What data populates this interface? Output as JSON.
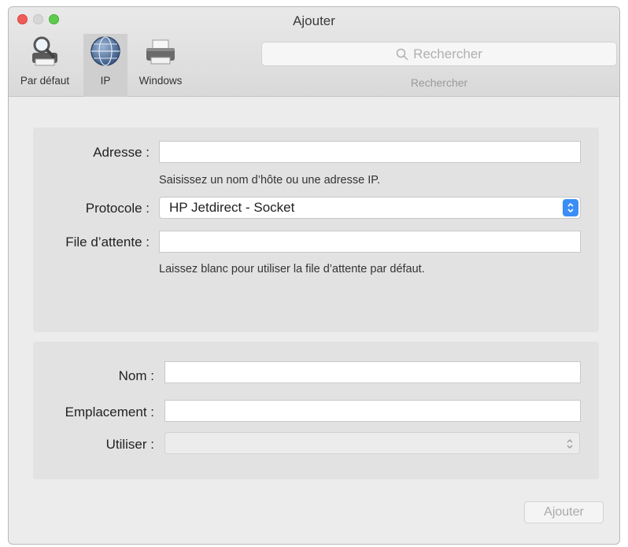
{
  "window": {
    "title": "Ajouter"
  },
  "toolbar": {
    "buttons": [
      {
        "label": "Par défaut",
        "icon": "printer-magnifier-icon",
        "selected": false
      },
      {
        "label": "IP",
        "icon": "network-globe-icon",
        "selected": true
      },
      {
        "label": "Windows",
        "icon": "windows-printer-icon",
        "selected": false
      }
    ],
    "search": {
      "placeholder": "Rechercher",
      "caption": "Rechercher"
    }
  },
  "connection": {
    "address_label": "Adresse :",
    "address_value": "",
    "address_hint": "Saisissez un nom d’hôte ou une adresse IP.",
    "protocol_label": "Protocole :",
    "protocol_value": "HP Jetdirect - Socket",
    "queue_label": "File d’attente :",
    "queue_value": "",
    "queue_hint": "Laissez blanc pour utiliser la file d’attente par défaut."
  },
  "info": {
    "name_label": "Nom :",
    "name_value": "",
    "location_label": "Emplacement :",
    "location_value": "",
    "use_label": "Utiliser :",
    "use_value": ""
  },
  "footer": {
    "add_button": "Ajouter"
  },
  "colors": {
    "accent": "#3b8ef5",
    "close": "#ef5b57",
    "maximize": "#5fcb4e",
    "panel": "#e2e2e2",
    "window": "#ececec"
  }
}
